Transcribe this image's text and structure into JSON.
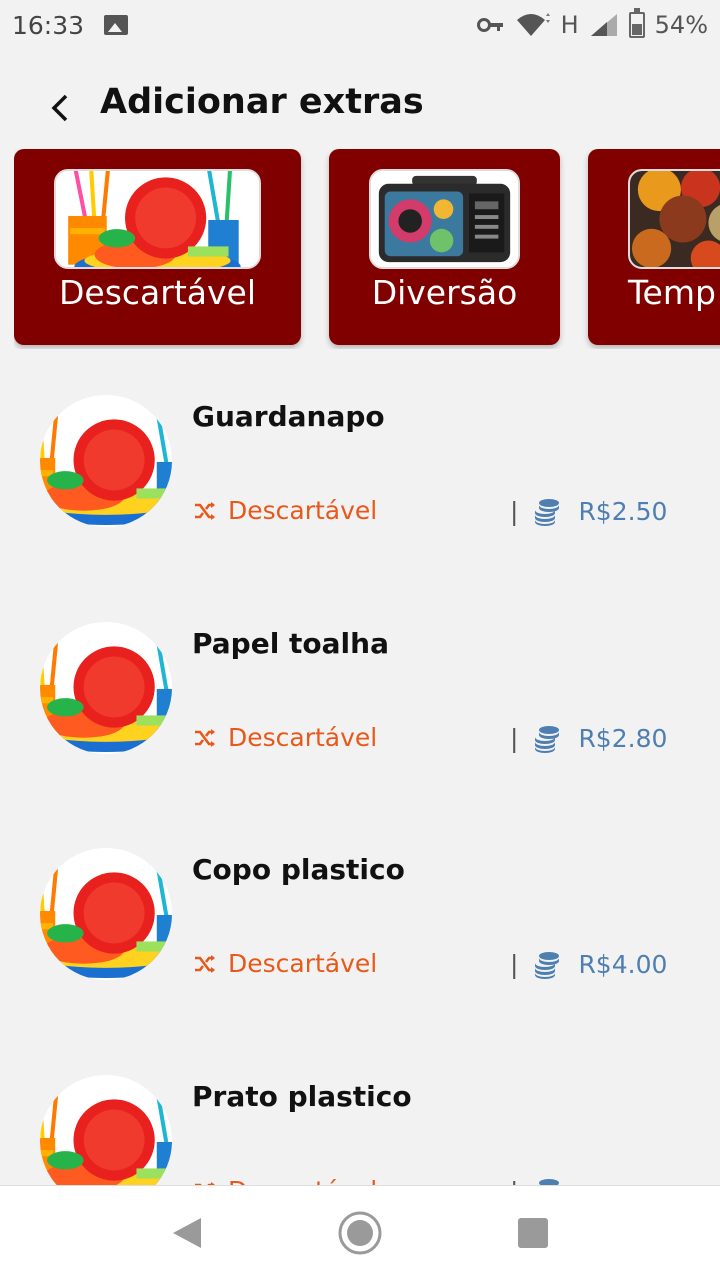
{
  "status": {
    "time": "16:33",
    "network": "H",
    "battery": "54%"
  },
  "header": {
    "title": "Adicionar extras"
  },
  "categories": [
    {
      "label": "Descartável"
    },
    {
      "label": "Diversão"
    },
    {
      "label": "Temp"
    }
  ],
  "items": [
    {
      "name": "Guardanapo",
      "category": "Descartável",
      "price": "R$2.50"
    },
    {
      "name": "Papel toalha",
      "category": "Descartável",
      "price": "R$2.80"
    },
    {
      "name": "Copo plastico",
      "category": "Descartável",
      "price": "R$4.00"
    },
    {
      "name": "Prato plastico",
      "category": "Descartável",
      "price": ""
    }
  ],
  "colors": {
    "card_bg": "#800000",
    "category_accent": "#e8581a",
    "price_accent": "#4f7fb0",
    "background": "#f2f2f3"
  },
  "price_separator": "|"
}
